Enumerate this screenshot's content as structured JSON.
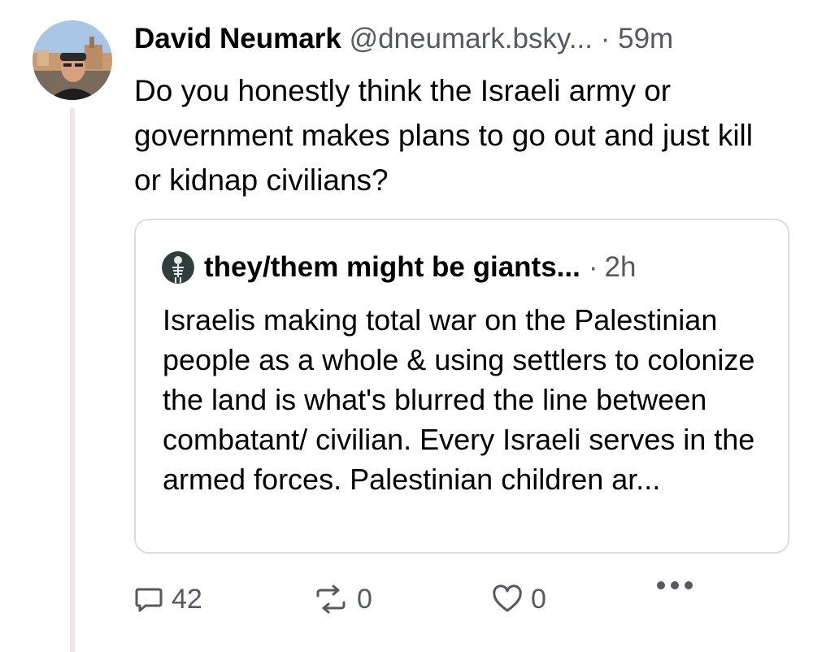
{
  "post": {
    "author_name": "David Neumark",
    "handle": "@dneumark.bsky...",
    "separator": "·",
    "time": "59m",
    "text": "Do you honestly think the Israeli army or government makes plans to go out and just kill or kidnap civilians?"
  },
  "quote": {
    "author_name": "they/them might be giants...",
    "separator": "·",
    "time": "2h",
    "text": "Israelis making total war on the Palestinian people as a whole & using settlers to colonize the land is what's blurred the line between combatant/ civilian. Every Israeli serves in the armed forces. Palestinian children ar..."
  },
  "actions": {
    "reply_count": "42",
    "repost_count": "0",
    "like_count": "0"
  },
  "icons": {
    "reply": "speech-bubble-icon",
    "repost": "repost-arrows-icon",
    "like": "heart-icon",
    "more": "ellipsis-icon"
  },
  "colors": {
    "text": "#000000",
    "muted": "#555a60",
    "thread_line": "#f0e4e8",
    "card_border": "#dcdcdc"
  }
}
